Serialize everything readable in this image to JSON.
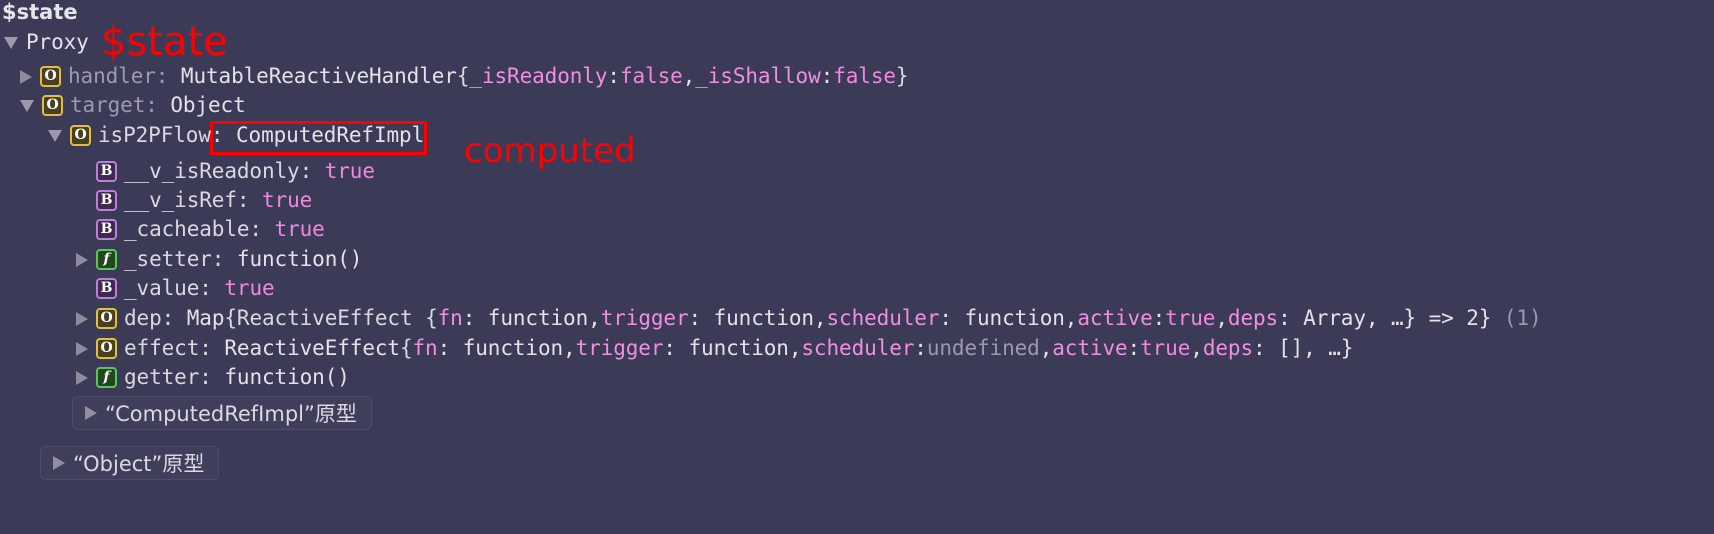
{
  "theme": {
    "background": "#3b3b58",
    "text": "#d8d8e0",
    "dim_text": "#9b9bab",
    "literal_pink": "#f087dd",
    "key_pink": "#ef8fe0",
    "undefined_grey": "#9a9aac",
    "annotation_red": "#ff0000",
    "badge_object_border": "#e0c040",
    "badge_boolean_border": "#bb7fe0",
    "badge_function_border": "#5cc45c"
  },
  "header": {
    "label": "$state"
  },
  "annotations": [
    {
      "id": "state",
      "text": "$state"
    },
    {
      "id": "computed",
      "text": "computed"
    }
  ],
  "tree": {
    "root": {
      "toggle": "expanded",
      "label": "Proxy"
    },
    "rows": [
      {
        "toggle": "collapsed",
        "badge": "O",
        "badge_type": "object",
        "key": "handler",
        "key_style": "dim",
        "value_class": "MutableReactiveHandler",
        "preview_open": "{",
        "preview_parts": [
          {
            "text": "_isReadonly",
            "style": "key"
          },
          {
            "text": ": ",
            "style": "plain"
          },
          {
            "text": "false",
            "style": "literal"
          },
          {
            "text": ", ",
            "style": "plain"
          },
          {
            "text": "_isShallow",
            "style": "key"
          },
          {
            "text": ": ",
            "style": "plain"
          },
          {
            "text": "false",
            "style": "literal"
          }
        ],
        "preview_close": "}"
      },
      {
        "toggle": "expanded",
        "badge": "O",
        "badge_type": "object",
        "key": "target",
        "key_style": "dim",
        "value_class": "Object"
      },
      {
        "toggle": "expanded",
        "badge": "O",
        "badge_type": "object",
        "key": "isP2PFlow",
        "key_style": "normal",
        "value_class": "ComputedRefImpl",
        "highlighted": true
      },
      {
        "toggle": "none",
        "badge": "B",
        "badge_type": "boolean",
        "key": "__v_isReadonly",
        "key_style": "normal",
        "value_literal": "true"
      },
      {
        "toggle": "none",
        "badge": "B",
        "badge_type": "boolean",
        "key": "__v_isRef",
        "key_style": "normal",
        "value_literal": "true"
      },
      {
        "toggle": "none",
        "badge": "B",
        "badge_type": "boolean",
        "key": "_cacheable",
        "key_style": "normal",
        "value_literal": "true"
      },
      {
        "toggle": "collapsed",
        "badge": "f",
        "badge_type": "function",
        "key": "_setter",
        "key_style": "normal",
        "value_plain": "function()"
      },
      {
        "toggle": "none",
        "badge": "B",
        "badge_type": "boolean",
        "key": "_value",
        "key_style": "normal",
        "value_literal": "true"
      },
      {
        "toggle": "collapsed",
        "badge": "O",
        "badge_type": "object",
        "key": "dep",
        "key_style": "normal",
        "value_class": "Map",
        "preview_open": " {ReactiveEffect {",
        "preview_parts": [
          {
            "text": "fn",
            "style": "key"
          },
          {
            "text": ": function, ",
            "style": "plain"
          },
          {
            "text": "trigger",
            "style": "key"
          },
          {
            "text": ": function, ",
            "style": "plain"
          },
          {
            "text": "scheduler",
            "style": "key"
          },
          {
            "text": ": function, ",
            "style": "plain"
          },
          {
            "text": "active",
            "style": "key"
          },
          {
            "text": ": ",
            "style": "plain"
          },
          {
            "text": "true",
            "style": "literal"
          },
          {
            "text": ", ",
            "style": "plain"
          },
          {
            "text": "deps",
            "style": "key"
          },
          {
            "text": ": Array, …} => 2}",
            "style": "plain"
          }
        ],
        "suffix": "(1)"
      },
      {
        "toggle": "collapsed",
        "badge": "O",
        "badge_type": "object",
        "key": "effect",
        "key_style": "normal",
        "value_class": "ReactiveEffect",
        "preview_open": " {",
        "preview_parts": [
          {
            "text": "fn",
            "style": "key"
          },
          {
            "text": ": function, ",
            "style": "plain"
          },
          {
            "text": "trigger",
            "style": "key"
          },
          {
            "text": ": function, ",
            "style": "plain"
          },
          {
            "text": "scheduler",
            "style": "key"
          },
          {
            "text": ": ",
            "style": "plain"
          },
          {
            "text": "undefined",
            "style": "grey"
          },
          {
            "text": ", ",
            "style": "plain"
          },
          {
            "text": "active",
            "style": "key"
          },
          {
            "text": ": ",
            "style": "plain"
          },
          {
            "text": "true",
            "style": "literal"
          },
          {
            "text": ", ",
            "style": "plain"
          },
          {
            "text": "deps",
            "style": "key"
          },
          {
            "text": ": [], …}",
            "style": "plain"
          }
        ]
      },
      {
        "toggle": "collapsed",
        "badge": "f",
        "badge_type": "function",
        "key": "getter",
        "key_style": "normal",
        "value_plain": "function()"
      }
    ],
    "prototypes": [
      {
        "id": "computedrefimpl-proto",
        "label": "“ComputedRefImpl”原型"
      },
      {
        "id": "object-proto",
        "label": "“Object”原型"
      }
    ]
  }
}
